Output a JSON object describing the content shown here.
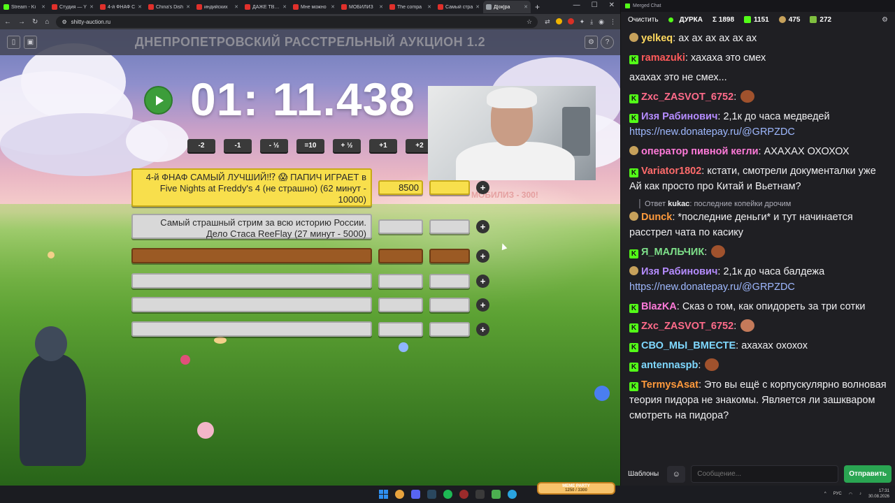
{
  "browser": {
    "tabs": [
      {
        "label": "Stream - Ki",
        "icon": "kick"
      },
      {
        "label": "Студия — Y",
        "icon": "yt"
      },
      {
        "label": "4-й ФНАФ С",
        "icon": "yt"
      },
      {
        "label": "China's Dish",
        "icon": "yt"
      },
      {
        "label": "индийских",
        "icon": "yt"
      },
      {
        "label": "ДАЖЕ ТВИТ",
        "icon": "yt"
      },
      {
        "label": "Мне можно",
        "icon": "yt"
      },
      {
        "label": "МОБИЛИЗ",
        "icon": "yt"
      },
      {
        "label": "The compa",
        "icon": "yt"
      },
      {
        "label": "Самый стра",
        "icon": "yt"
      },
      {
        "label": "Д[ок]ра",
        "icon": "doc"
      }
    ],
    "url": "shitty-auction.ru"
  },
  "auction": {
    "title": "ДНЕПРОПЕТРОВСКИЙ РАССТРЕЛЬНЫЙ АУКЦИОН 1.2",
    "timer": "01: 11.438",
    "adjust_buttons": [
      "-2",
      "-1",
      "- ½",
      "=10",
      "+ ½",
      "+1",
      "+2"
    ],
    "overlay_text": "МОБИЛИЗ - 300!",
    "lots": [
      {
        "name": "4-й ФНАФ САМЫЙ ЛУЧШИЙ!⁉ 😱 ПАПИЧ ИГРАЕТ в Five Nights at Freddy's 4 (не страшно) (62 минут - 10000)",
        "amount": "8500"
      },
      {
        "name": "Самый страшный стрим за всю историю России. Дело Стаса ReeFlay (27 минут - 5000)",
        "amount": ""
      },
      {
        "name": "",
        "amount": ""
      },
      {
        "name": "",
        "amount": ""
      },
      {
        "name": "",
        "amount": ""
      },
      {
        "name": "",
        "amount": ""
      }
    ],
    "plus_label": "+"
  },
  "chat": {
    "window_title": "Merged Chat",
    "clear_label": "Очистить",
    "channel": "ДУРКА",
    "stats": {
      "sum": "Σ 1898",
      "kick": "1151",
      "yt": "475",
      "other": "272"
    },
    "messages": [
      {
        "user": "yelkeq",
        "color": "#ffd95e",
        "badge": "pig",
        "text": "ах ах ах ах ах ах"
      },
      {
        "user": "ramazuki",
        "color": "#ff5a5a",
        "badge": "kick",
        "text": "хахаха это смех"
      },
      {
        "user": "",
        "color": "#efeff1",
        "badge": "",
        "text": "ахахах это не смех..."
      },
      {
        "user": "Zxc_ZASVOT_6752",
        "color": "#ff6b8a",
        "badge": "kick",
        "text": ""
      },
      {
        "user": "Изя Рабинович",
        "color": "#b58cff",
        "badge": "kick",
        "text": "2,1к до часа медведей",
        "link": "https://new.donatepay.ru/@GRPZDC"
      },
      {
        "user": "оператор пивной кегли",
        "color": "#ff7ad9",
        "badge": "pig",
        "text": "АХАХАХ ОХОХОХ"
      },
      {
        "user": "Variator1802",
        "color": "#ff6b6b",
        "badge": "kick",
        "text": "кстати, смотрели документалки уже Ай как просто про Китай и Вьетнам?"
      },
      {
        "user": "Dunck",
        "color": "#ff9a3c",
        "badge": "pig",
        "text": "*последние деньги* и тут начинается расстрел чата по касику",
        "reply_user": "kukac",
        "reply_text": "последние копейки дрочим"
      },
      {
        "user": "Я_МАЛЬЧИК",
        "color": "#7ee08a",
        "badge": "kick",
        "text": ""
      },
      {
        "user": "Изя Рабинович",
        "color": "#b58cff",
        "badge": "pig",
        "text": "2,1к до часа балдежа",
        "link": "https://new.donatepay.ru/@GRPZDC"
      },
      {
        "user": "BlazKA",
        "color": "#ff7ad9",
        "badge": "kick",
        "text": "Сказ о том, как опидореть за три сотки"
      },
      {
        "user": "Zxc_ZASVOT_6752",
        "color": "#ff6b8a",
        "badge": "kick",
        "text": ""
      },
      {
        "user": "СВО_МЫ_ВМЕСТЕ",
        "color": "#7fd8ff",
        "badge": "kick",
        "text": "ахахах охохох"
      },
      {
        "user": "antennaspb",
        "color": "#7fd8ff",
        "badge": "kick",
        "text": ""
      },
      {
        "user": "TermysAsat",
        "color": "#ff9a3c",
        "badge": "kick",
        "text": "Это вы ещё с корпускулярно волновая теория пидора не знакомы. Является ли зашкваром смотреть на пидора?"
      }
    ],
    "templates_label": "Шаблоны",
    "input_placeholder": "Сообщение...",
    "send_label": "Отправить"
  },
  "taskbar": {
    "widget_title": "MEME PARTY",
    "widget_value": "1250 / 3300",
    "lang": "РУС",
    "time": "17:31",
    "date": "30.08.2026"
  }
}
